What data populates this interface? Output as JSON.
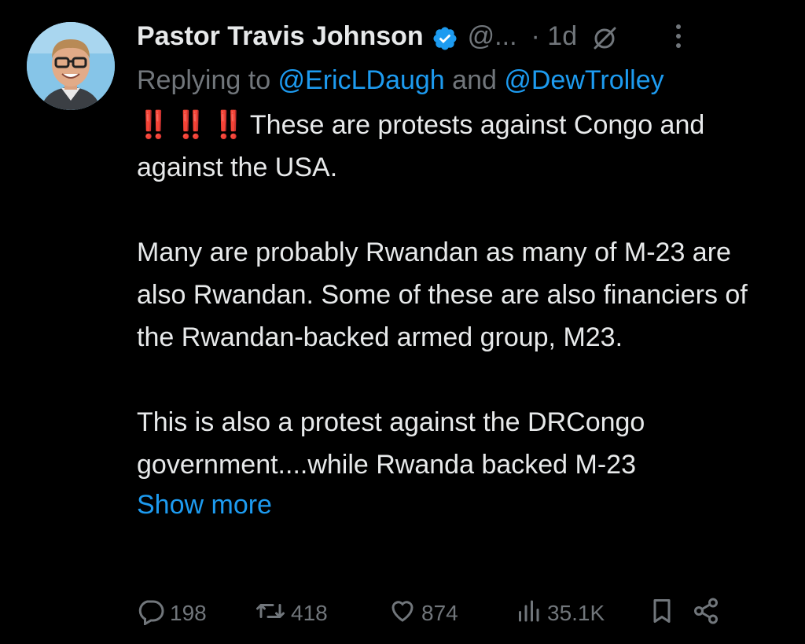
{
  "tweet": {
    "author": {
      "display_name": "Pastor Travis Johnson",
      "handle": "@...",
      "verified": true
    },
    "time": "· 1d",
    "replying_to": {
      "prefix": "Replying to ",
      "mention_1": "@EricLDaugh",
      "conjunction": " and ",
      "mention_2": "@DewTrolley"
    },
    "emoji_text": "‼️ ‼️ ‼️",
    "paragraphs": [
      "These are protests against Congo and against the USA.",
      "Many are probably Rwandan as many of M-23 are also Rwandan. Some of these are also financiers of the Rwandan-backed armed group, M23.",
      "This is also a protest against the DRCongo government....while Rwanda backed M-23"
    ],
    "show_more": "Show more"
  },
  "actions": {
    "replies": "198",
    "reposts": "418",
    "likes": "874",
    "views": "35.1K"
  },
  "colors": {
    "background": "#000000",
    "text": "#e7e9ea",
    "muted": "#71767b",
    "link": "#1d9bf0",
    "verified": "#1d9bf0",
    "emoji_red": "#f4212e"
  },
  "icons": [
    "verified-badge-icon",
    "grok-icon",
    "more-vertical-icon",
    "reply-icon",
    "repost-icon",
    "like-icon",
    "views-icon",
    "bookmark-icon",
    "share-icon"
  ]
}
